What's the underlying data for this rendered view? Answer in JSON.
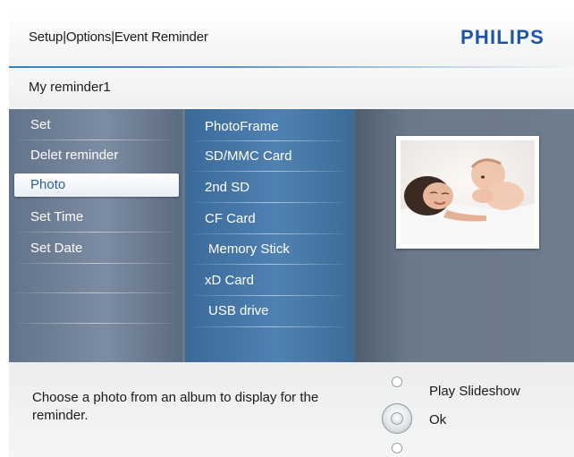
{
  "header": {
    "breadcrumb": "Setup|Options|Event Reminder",
    "brand": "PHILIPS"
  },
  "title": "My reminder1",
  "menu": {
    "items": [
      {
        "label": "Set"
      },
      {
        "label": "Delet reminder"
      },
      {
        "label": "Photo",
        "selected": true
      },
      {
        "label": "Set Time"
      },
      {
        "label": "Set Date"
      }
    ]
  },
  "sources": {
    "items": [
      {
        "label": "PhotoFrame"
      },
      {
        "label": "SD/MMC Card"
      },
      {
        "label": "2nd SD"
      },
      {
        "label": "CF Card"
      },
      {
        "label": "Memory Stick"
      },
      {
        "label": "xD Card"
      },
      {
        "label": "USB drive"
      }
    ]
  },
  "preview": {
    "icon": "mother-and-baby-photo"
  },
  "footer": {
    "help": "Choose a photo from an album to display for the reminder.",
    "actions": [
      {
        "label": "Play Slideshow",
        "icon": "small-circle-icon"
      },
      {
        "label": "Ok",
        "icon": "ok-dial-icon"
      }
    ]
  },
  "colors": {
    "brand": "#1e55a8",
    "selected_text": "#2c5fa0",
    "menu_bg": "#6b7886",
    "source_bg": "#4f81b2"
  }
}
